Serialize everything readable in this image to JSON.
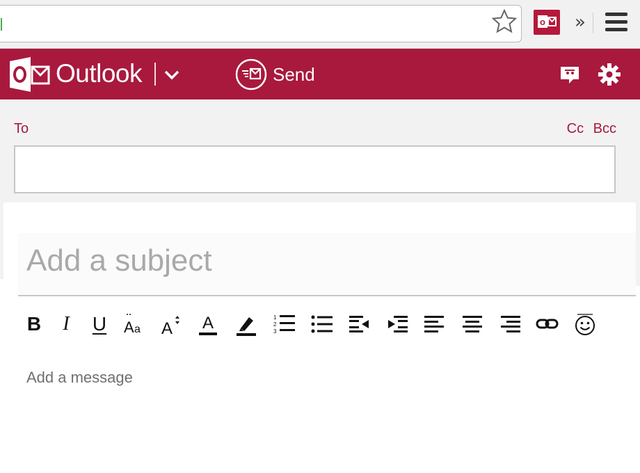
{
  "browser": {
    "bookmark_star_icon": "star-outline",
    "extension_icon": "outlook-extension",
    "overflow_label": "»",
    "menu_icon": "hamburger"
  },
  "app": {
    "title": "Outlook",
    "brand_color": "#a8193d",
    "logo_letter": "O",
    "send_label": "Send",
    "feedback_icon": "feedback",
    "settings_icon": "gear"
  },
  "recipients": {
    "to_label": "To",
    "cc_label": "Cc",
    "bcc_label": "Bcc",
    "to_value": ""
  },
  "subject": {
    "placeholder": "Add a subject",
    "value": ""
  },
  "toolbar": {
    "bold_label": "B",
    "italic_label": "I",
    "underline_label": "U",
    "items": [
      "bold",
      "italic",
      "underline",
      "font-face",
      "font-size",
      "font-color",
      "highlight",
      "numbered-list",
      "bulleted-list",
      "decrease-indent",
      "increase-indent",
      "align-left",
      "align-center",
      "align-right",
      "insert-link",
      "emoticons"
    ]
  },
  "message": {
    "placeholder": "Add a message",
    "value": ""
  }
}
